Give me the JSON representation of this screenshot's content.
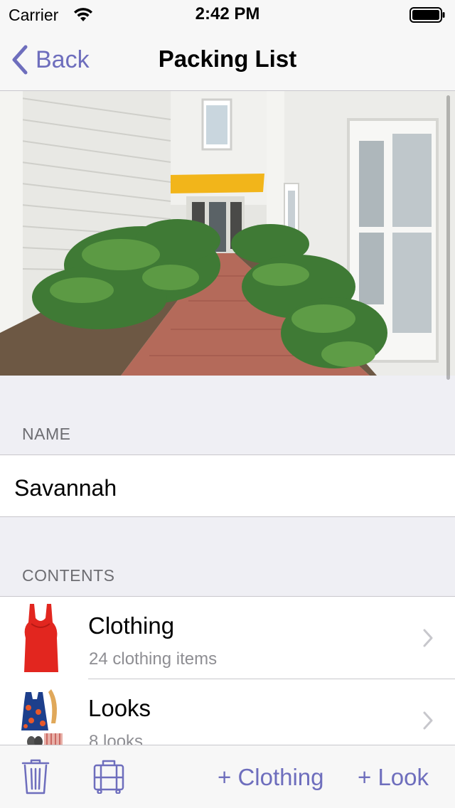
{
  "status_bar": {
    "carrier": "Carrier",
    "time": "2:42 PM"
  },
  "nav": {
    "back_label": "Back",
    "title": "Packing List"
  },
  "name_section": {
    "header": "NAME",
    "value": "Savannah"
  },
  "contents_section": {
    "header": "CONTENTS",
    "rows": [
      {
        "title": "Clothing",
        "subtitle": "24 clothing items",
        "icon": "tank-top-thumbnail"
      },
      {
        "title": "Looks",
        "subtitle": "8 looks",
        "icon": "outfit-thumbnail"
      }
    ]
  },
  "toolbar": {
    "add_clothing_label": "+ Clothing",
    "add_look_label": "+ Look",
    "trash_icon": "trash-icon",
    "luggage_icon": "suitcase-icon"
  },
  "colors": {
    "accent": "#6e6ebd",
    "background": "#efeff4",
    "bar": "#f7f7f7"
  }
}
